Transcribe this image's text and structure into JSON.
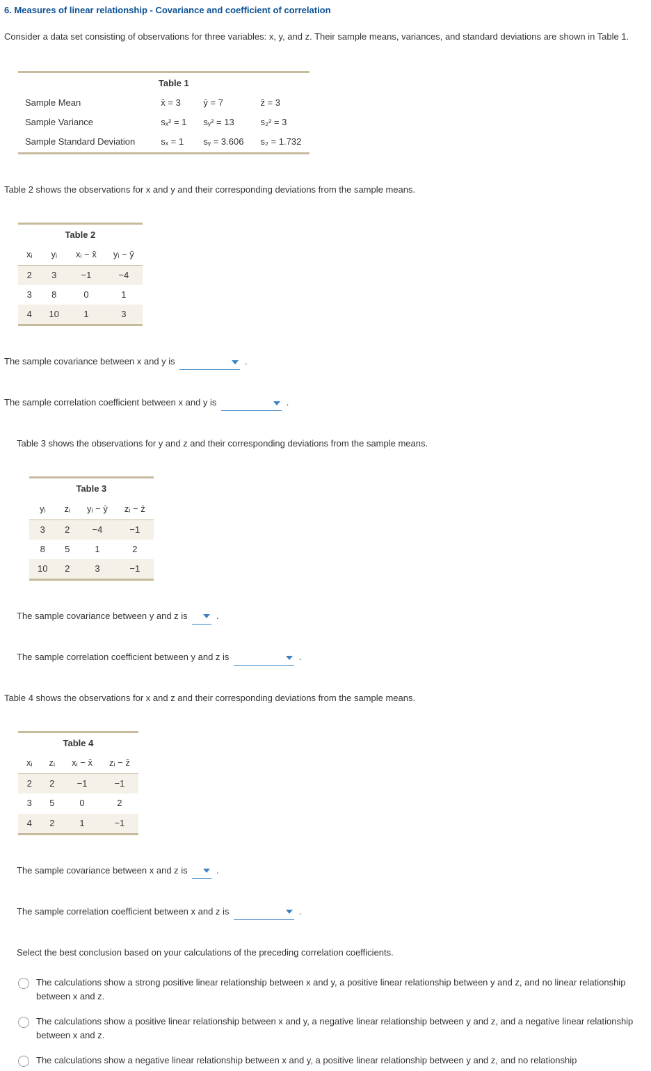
{
  "title": "6. Measures of linear relationship - Covariance and coefficient of correlation",
  "intro": "Consider a data set consisting of observations for three variables: x, y, and z. Their sample means, variances, and standard deviations are shown in Table 1.",
  "table1": {
    "title": "Table 1",
    "row1_lbl": "Sample Mean",
    "row1_c1": "x̄ = 3",
    "row1_c2": "ȳ = 7",
    "row1_c3": "z̄ = 3",
    "row2_lbl": "Sample Variance",
    "row2_c1": "sₓ² = 1",
    "row2_c2": "sᵧ² = 13",
    "row2_c3": "s₂² = 3",
    "row3_lbl": "Sample Standard Deviation",
    "row3_c1": "sₓ = 1",
    "row3_c2": "sᵧ = 3.606",
    "row3_c3": "s₂ = 1.732"
  },
  "para2": "Table 2 shows the observations for x and y and their corresponding deviations from the sample means.",
  "table2": {
    "title": "Table 2",
    "h1": "xᵢ",
    "h2": "yᵢ",
    "h3": "xᵢ − x̄",
    "h4": "yᵢ − ȳ",
    "r1": [
      "2",
      "3",
      "−1",
      "−4"
    ],
    "r2": [
      "3",
      "8",
      "0",
      "1"
    ],
    "r3": [
      "4",
      "10",
      "1",
      "3"
    ]
  },
  "q1": "The sample covariance between x and y is",
  "q2": "The sample correlation coefficient between x and y is",
  "para3": "Table 3 shows the observations for y and z and their corresponding deviations from the sample means.",
  "table3": {
    "title": "Table 3",
    "h1": "yᵢ",
    "h2": "zᵢ",
    "h3": "yᵢ − ȳ",
    "h4": "zᵢ − z̄",
    "r1": [
      "3",
      "2",
      "−4",
      "−1"
    ],
    "r2": [
      "8",
      "5",
      "1",
      "2"
    ],
    "r3": [
      "10",
      "2",
      "3",
      "−1"
    ]
  },
  "q3": "The sample covariance between y and z is",
  "q4": "The sample correlation coefficient between y and z is",
  "para4": "Table 4 shows the observations for x and z and their corresponding deviations from the sample means.",
  "table4": {
    "title": "Table 4",
    "h1": "xᵢ",
    "h2": "zᵢ",
    "h3": "xᵢ − x̄",
    "h4": "zᵢ − z̄",
    "r1": [
      "2",
      "2",
      "−1",
      "−1"
    ],
    "r2": [
      "3",
      "5",
      "0",
      "2"
    ],
    "r3": [
      "4",
      "2",
      "1",
      "−1"
    ]
  },
  "q5": "The sample covariance between x and z is",
  "q6": "The sample correlation coefficient between x and z is",
  "conclude": "Select the best conclusion based on your calculations of the preceding correlation coefficients.",
  "mc": {
    "a": "The calculations show a strong positive linear relationship between x and y, a positive linear relationship between y and z, and no linear relationship between x and z.",
    "b": "The calculations show a positive linear relationship between x and y, a negative linear relationship between y and z, and a negative linear relationship between x and z.",
    "c": "The calculations show a negative linear relationship between x and y, a positive linear relationship between y and z, and no relationship"
  },
  "period": "."
}
